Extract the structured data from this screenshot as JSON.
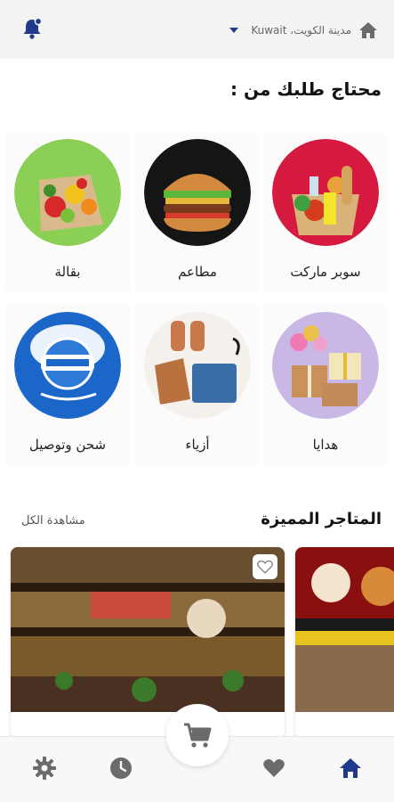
{
  "header": {
    "location_text": "مدينة الكويت، Kuwait",
    "icons": {
      "home": "home-icon",
      "dropdown": "caret-down-icon",
      "notifications": "bell-icon"
    }
  },
  "main": {
    "section_title": "محتاج طلبك من :",
    "categories": [
      {
        "label": "سوبر ماركت"
      },
      {
        "label": "مطاعم"
      },
      {
        "label": "بقالة"
      },
      {
        "label": "هدايا"
      },
      {
        "label": "أزياء"
      },
      {
        "label": "شحن وتوصيل"
      }
    ],
    "featured": {
      "title": "المتاجر المميزة",
      "see_all": "مشاهدة الكل"
    }
  },
  "bottom_nav": {
    "items": [
      "home-icon",
      "heart-icon",
      "cart-icon",
      "clock-icon",
      "gear-icon"
    ]
  },
  "colors": {
    "accent": "#1f3a8a",
    "icon_gray": "#6b6b6b",
    "header_bg": "#f3f3f3"
  }
}
